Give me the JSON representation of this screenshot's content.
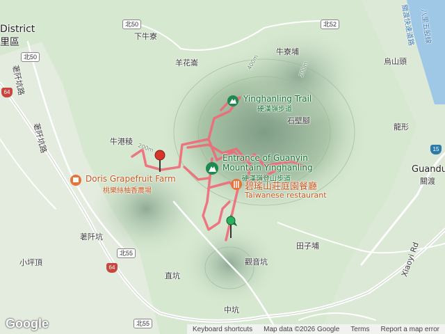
{
  "map": {
    "labels": {
      "district": "District",
      "district_zh": "里區",
      "xia_niu_liao": "下牛寮",
      "yang_hua_zhai": "羊花崙",
      "niu_liao_bu": "牛寮埔",
      "wu_shan_tou": "烏山頭",
      "shi_bi_jiao": "石壁腳",
      "long_xing": "龍形",
      "niu_gang_leng": "牛港稜",
      "guandu": "Guandu",
      "guandu_zh": "關渡",
      "tian_zi_bu": "田子埔",
      "guan_yin_keng": "觀音坑",
      "shu_qian_keng": "荖阡坑",
      "xiao_ping_ding": "小坪頂",
      "zhi_keng": "直坑",
      "zhong_keng": "中坑",
      "xiaoyi_rd": "Xiaoyi Rd",
      "shu_qian_keng_rd": "荖阡坑路",
      "road_zh_left": "荖阡坑路",
      "guandu_road_zh": "關渡快速道路",
      "bali_road_zh": "八里五股線"
    },
    "pois": {
      "trail_en": "Yinghanling Trail",
      "trail_zh": "硬漢嶺步道",
      "entrance_en_1": "Entrance of Guanyin",
      "entrance_en_2": "Mountain Yinghanling",
      "entrance_zh": "硬漢嶺登山步道",
      "farm_en": "Doris Grapefruit Farm",
      "farm_zh": "桃樂絲柚香農場",
      "restaurant_zh": "碧瑤山莊庭園餐廳",
      "restaurant_en": "Taiwanese restaurant"
    },
    "road_shields": {
      "north50_a": "北50",
      "north50_b": "北50",
      "north52": "北52",
      "north55_a": "北55",
      "north55_b": "北55"
    },
    "highways": {
      "hw64_a": "64",
      "hw64_b": "64",
      "hw15": "15"
    },
    "contours": {
      "c200a": "200m",
      "c200b": "200m",
      "c400": "400m"
    },
    "colors": {
      "route": "#f06a78",
      "terrain": "#cfe3c9",
      "water": "#9fc8e6",
      "road": "#ffffff",
      "poi_green": "#1e8a4f",
      "poi_orange": "#e8733a"
    }
  },
  "footer": {
    "logo": "Google",
    "shortcuts": "Keyboard shortcuts",
    "mapdata": "Map data ©2026 Google",
    "terms": "Terms",
    "report": "Report a map error"
  }
}
